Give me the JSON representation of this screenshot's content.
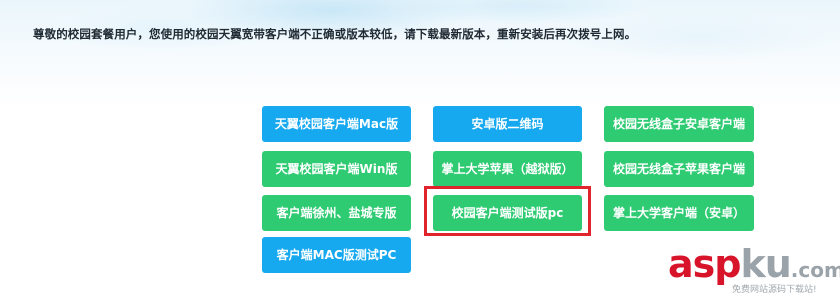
{
  "notice": "尊敬的校园套餐用户，您使用的校园天翼宽带客户端不正确或版本较低，请下载最新版本，重新安装后再次拨号上网。",
  "buttons": {
    "r1c1": "天翼校园客户端Mac版",
    "r1c2": "安卓版二维码",
    "r1c3": "校园无线盒子安卓客户端",
    "r2c1": "天翼校园客户端Win版",
    "r2c2": "掌上大学苹果（越狱版）",
    "r2c3": "校园无线盒子苹果客户端",
    "r3c1": "客户端徐州、盐城专版",
    "r3c2": "校园客户端测试版pc",
    "r3c3": "掌上大学客户端（安卓）",
    "r4c1": "客户端MAC版测试PC"
  },
  "colors": {
    "button_blue": "#16a9f0",
    "button_green": "#2fcb73",
    "highlight_red": "#e1232b"
  },
  "watermark": {
    "asp": "asp",
    "ku": "ku",
    "com": ".com",
    "subtitle": "免费网站源码下载站!"
  }
}
